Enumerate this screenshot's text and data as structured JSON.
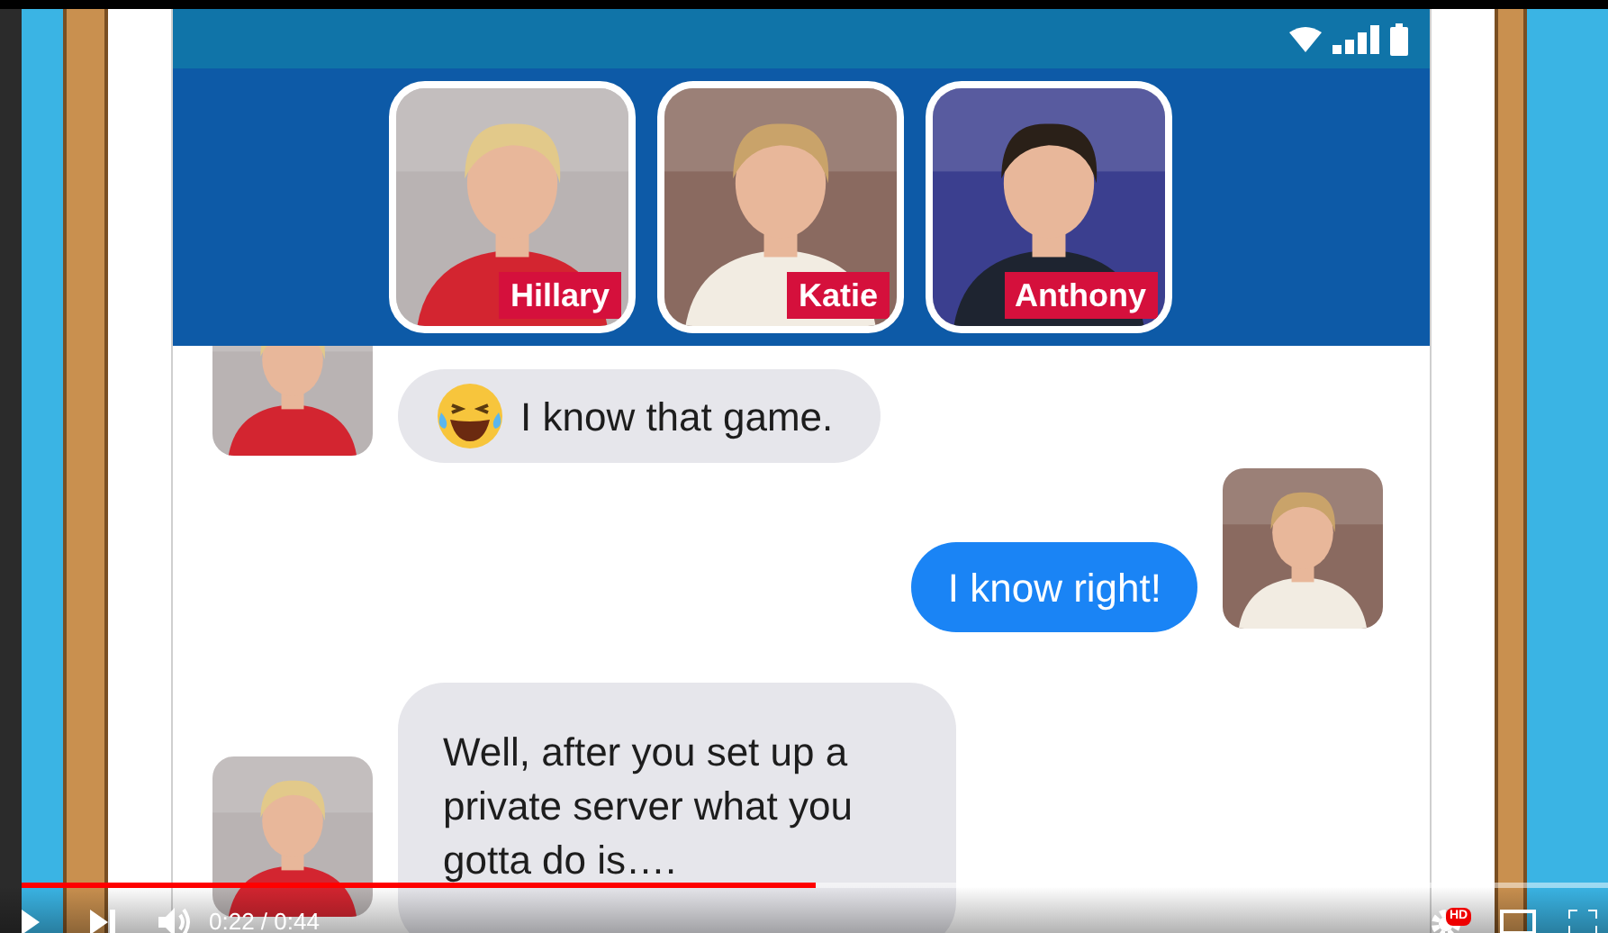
{
  "contacts": [
    {
      "name": "Hillary"
    },
    {
      "name": "Katie"
    },
    {
      "name": "Anthony"
    }
  ],
  "messages": [
    {
      "kind": "incoming",
      "emoji": true,
      "text": "I know that game."
    },
    {
      "kind": "outgoing",
      "emoji": false,
      "text": "I know right!"
    },
    {
      "kind": "incoming",
      "emoji": false,
      "text": "Well, after you set up a private server what you gotta do is…."
    }
  ],
  "player": {
    "time": "0:22 / 0:44",
    "badge": "HD",
    "level": 0.5
  }
}
